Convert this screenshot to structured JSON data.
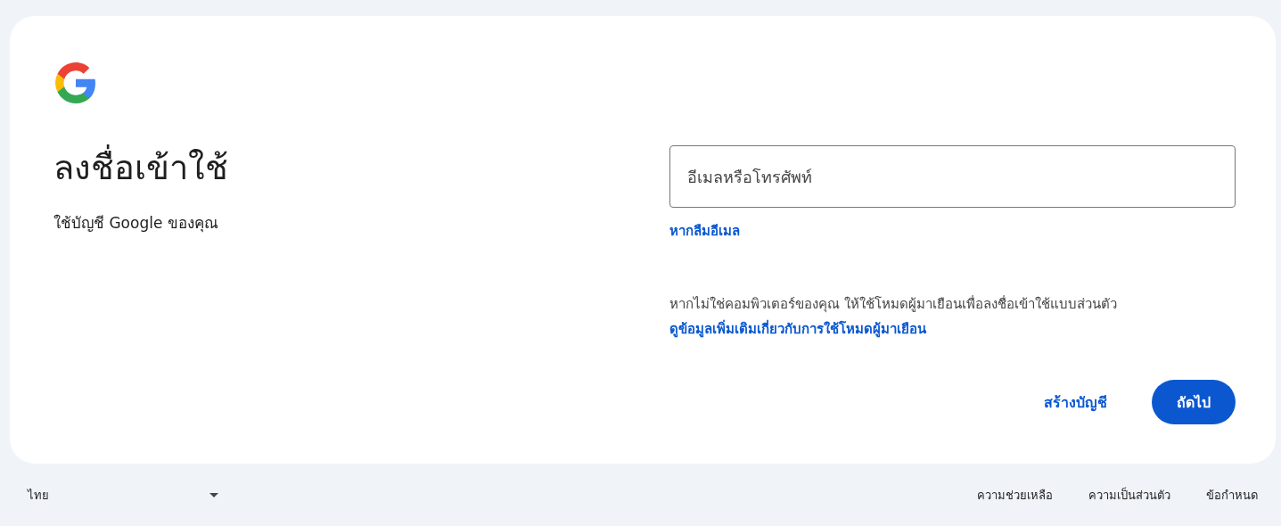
{
  "card": {
    "title": "ลงชื่อเข้าใช้",
    "subtitle": "ใช้บัญชี Google ของคุณ",
    "email_field": {
      "placeholder": "อีเมลหรือโทรศัพท์"
    },
    "forgot_email_link": "หากลืมอีเมล",
    "guest_notice": "หากไม่ใช่คอมพิวเตอร์ของคุณ ให้ใช้โหมดผู้มาเยือนเพื่อลงชื่อเข้าใช้แบบส่วนตัว",
    "guest_link": "ดูข้อมูลเพิ่มเติมเกี่ยวกับการใช้โหมดผู้มาเยือน",
    "buttons": [
      {
        "label": "สร้างบัญชี",
        "kind": "text"
      },
      {
        "label": "ถัดไป",
        "kind": "filled"
      }
    ]
  },
  "footer": {
    "language": "ไทย",
    "links": [
      "ความช่วยเหลือ",
      "ความเป็นส่วนตัว",
      "ข้อกำหนด"
    ]
  }
}
